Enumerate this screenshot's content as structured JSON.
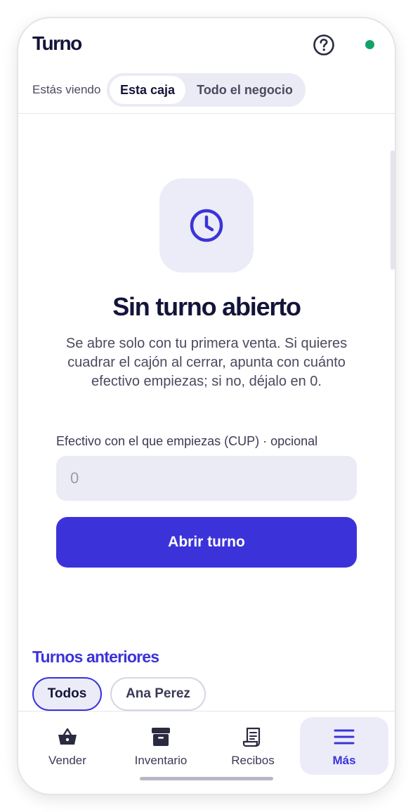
{
  "header": {
    "title": "Turno",
    "help_icon": "question-circle-icon",
    "status_color": "#12a36a"
  },
  "viewing": {
    "label": "Estás viendo",
    "options": [
      "Esta caja",
      "Todo el negocio"
    ],
    "selected": "Esta caja"
  },
  "empty_state": {
    "icon": "clock-icon",
    "title": "Sin turno abierto",
    "description": "Se abre solo con tu primera venta. Si quieres cuadrar el cajón al cerrar, apunta con cuánto efectivo empiezas; si no, déjalo en 0."
  },
  "cash_field": {
    "label": "Efectivo con el que empiezas (CUP) · opcional",
    "placeholder": "0",
    "value": ""
  },
  "open_button": "Abrir turno",
  "previous": {
    "title": "Turnos anteriores",
    "filters": [
      "Todos",
      "Ana Perez"
    ],
    "selected": "Todos"
  },
  "nav": {
    "items": [
      {
        "label": "Vender",
        "icon": "basket-icon"
      },
      {
        "label": "Inventario",
        "icon": "archive-box-icon"
      },
      {
        "label": "Recibos",
        "icon": "receipt-icon"
      },
      {
        "label": "Más",
        "icon": "menu-icon"
      }
    ],
    "active": "Más"
  },
  "colors": {
    "accent": "#3b33d9",
    "accent_soft": "#ececf9",
    "status_online": "#12a36a"
  }
}
